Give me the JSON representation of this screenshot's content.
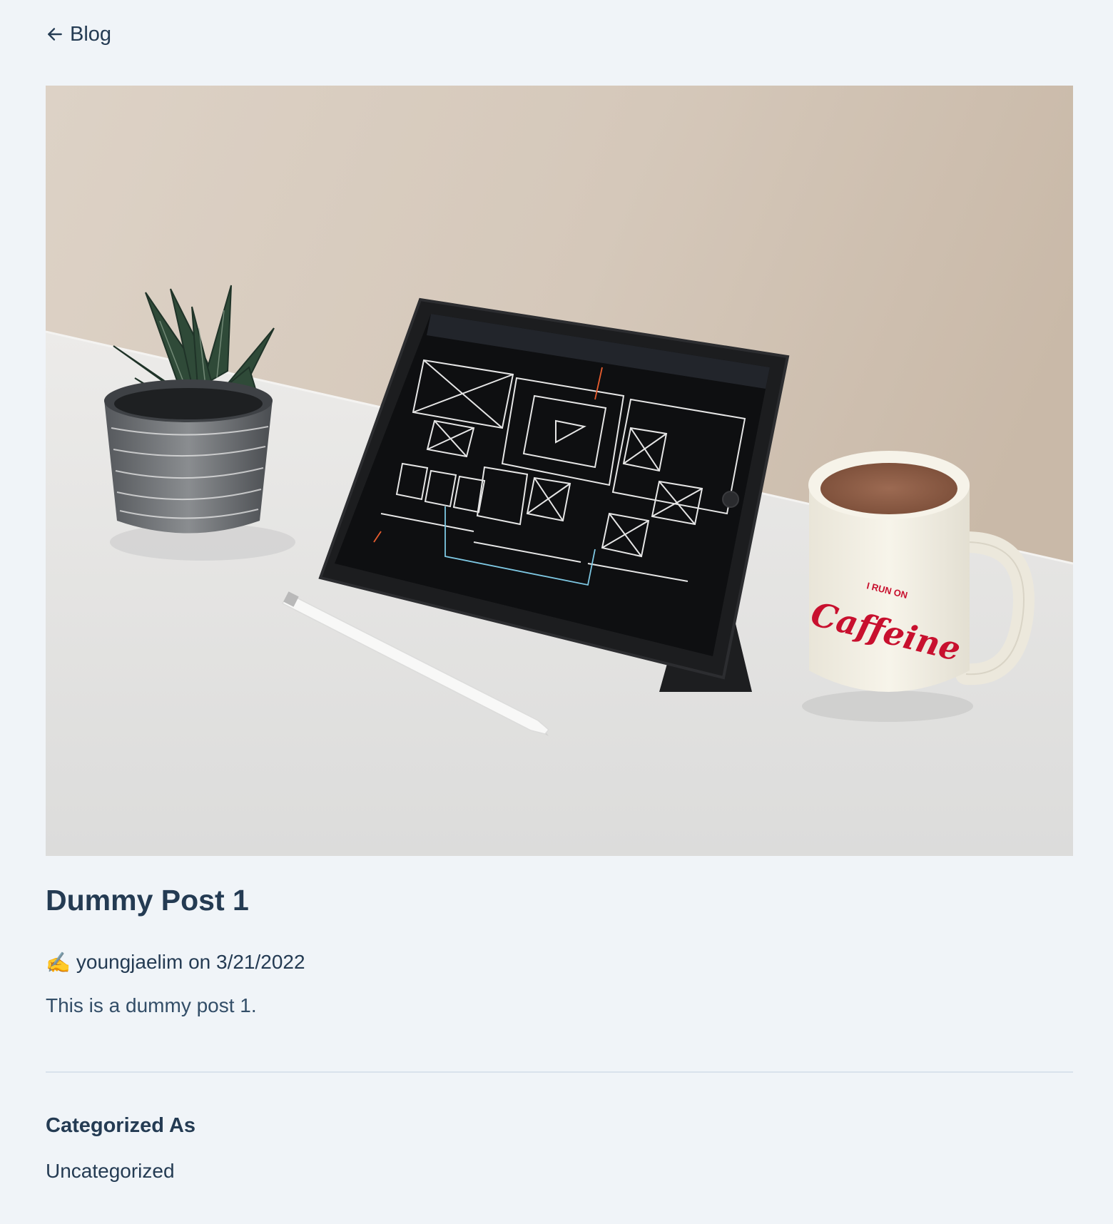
{
  "nav": {
    "back_label": "Blog"
  },
  "post": {
    "title": "Dummy Post 1",
    "author_emoji": "✍️",
    "byline": "youngjaelim on 3/21/2022",
    "body": "This is a dummy post 1."
  },
  "categories": {
    "heading": "Categorized As",
    "items": [
      "Uncategorized"
    ]
  },
  "hero_image": {
    "mug_text_small": "I RUN ON",
    "mug_text_large": "Caffeine"
  },
  "colors": {
    "background": "#f0f4f8",
    "text": "#243b53",
    "divider": "#d9e2ec",
    "mug_red": "#c8102e"
  }
}
